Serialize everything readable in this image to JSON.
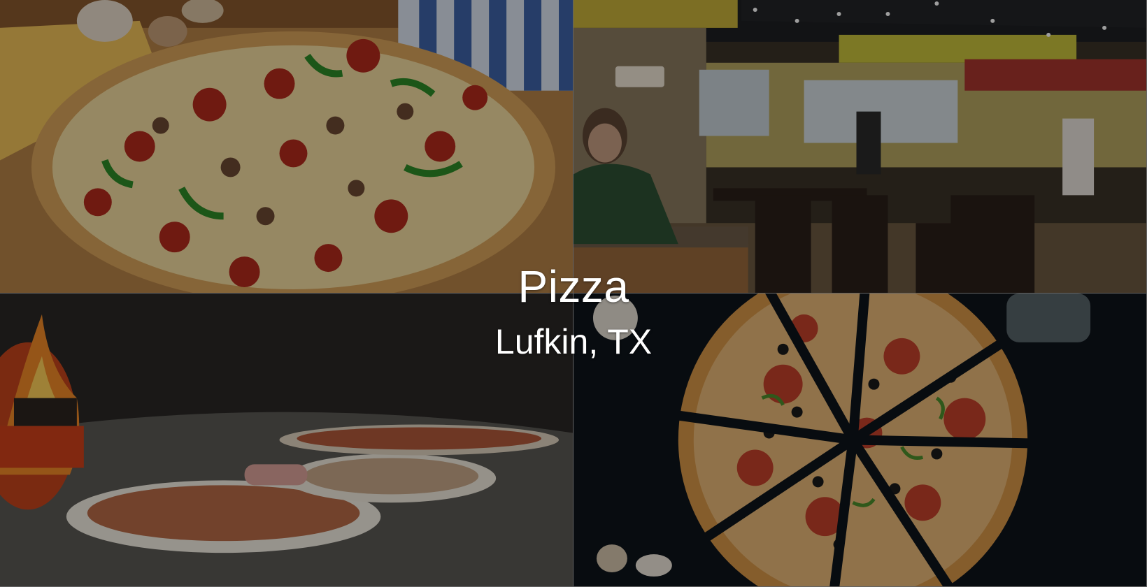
{
  "hero": {
    "title": "Pizza",
    "subtitle": "Lufkin, TX"
  },
  "tiles": [
    {
      "name": "pizza-closeup-photo"
    },
    {
      "name": "restaurant-interior-photo"
    },
    {
      "name": "wood-fired-oven-photo"
    },
    {
      "name": "sliced-pizza-topdown-photo"
    }
  ],
  "colors": {
    "overlay": "#000000",
    "text": "#ffffff"
  }
}
